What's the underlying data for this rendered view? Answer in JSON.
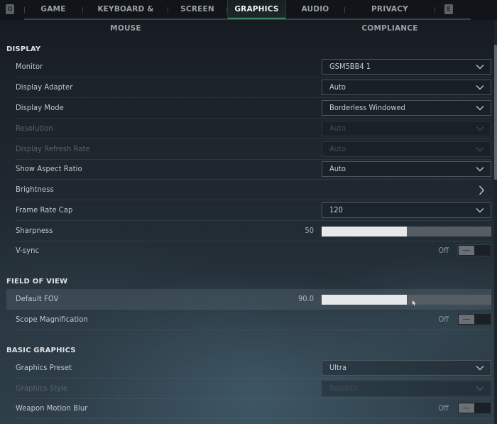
{
  "tabs": {
    "prev_key": "Q",
    "next_key": "E",
    "items": [
      {
        "label": "GAME",
        "active": false
      },
      {
        "label": "KEYBOARD & MOUSE",
        "active": false
      },
      {
        "label": "SCREEN",
        "active": false
      },
      {
        "label": "GRAPHICS",
        "active": true
      },
      {
        "label": "AUDIO",
        "active": false
      },
      {
        "label": "PRIVACY COMPLIANCE",
        "active": false
      }
    ]
  },
  "colors": {
    "accent": "#3fd68f",
    "slider_fill": "#e6e8ea",
    "slider_track": "#565d63"
  },
  "display": {
    "title": "DISPLAY",
    "monitor": {
      "label": "Monitor",
      "value": "GSM5BB4 1"
    },
    "display_adapter": {
      "label": "Display Adapter",
      "value": "Auto"
    },
    "display_mode": {
      "label": "Display Mode",
      "value": "Borderless Windowed"
    },
    "resolution": {
      "label": "Resolution",
      "value": "Auto",
      "disabled": true
    },
    "refresh_rate": {
      "label": "Display Refresh Rate",
      "value": "Auto",
      "disabled": true
    },
    "aspect_ratio": {
      "label": "Show Aspect Ratio",
      "value": "Auto"
    },
    "brightness": {
      "label": "Brightness"
    },
    "frame_rate_cap": {
      "label": "Frame Rate Cap",
      "value": "120"
    },
    "sharpness": {
      "label": "Sharpness",
      "value": "50",
      "fill_fraction": 0.5
    },
    "vsync": {
      "label": "V-sync",
      "value": "Off"
    }
  },
  "field_of_view": {
    "title": "FIELD OF VIEW",
    "default_fov": {
      "label": "Default FOV",
      "value": "90.0",
      "fill_fraction": 0.5
    },
    "scope_magnification": {
      "label": "Scope Magnification",
      "value": "Off"
    }
  },
  "basic_graphics": {
    "title": "BASIC GRAPHICS",
    "graphics_preset": {
      "label": "Graphics Preset",
      "value": "Ultra"
    },
    "graphics_style": {
      "label": "Graphics Style",
      "value": "Realistic",
      "disabled": true
    },
    "weapon_motion_blur": {
      "label": "Weapon Motion Blur",
      "value": "Off"
    }
  }
}
